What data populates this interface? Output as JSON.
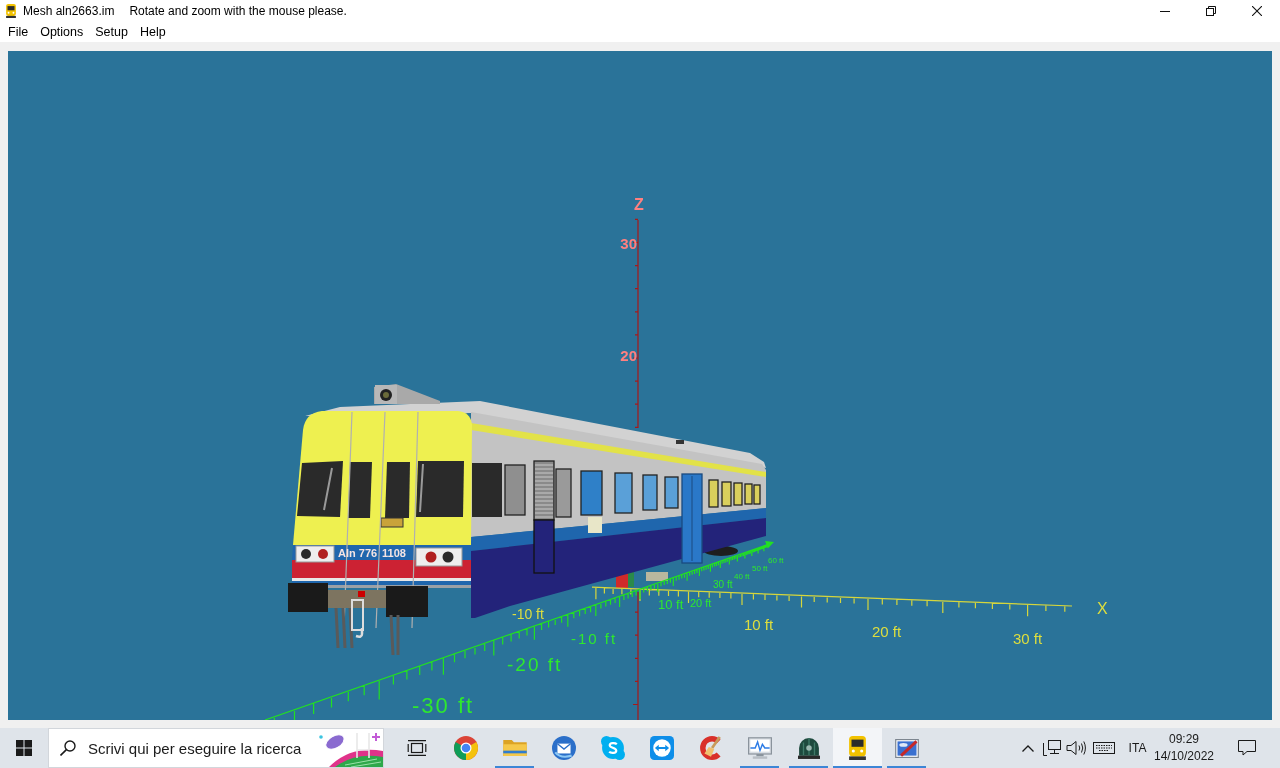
{
  "window": {
    "title": "Mesh aln2663.im",
    "hint": "Rotate and zoom with the mouse please."
  },
  "menu": [
    "File",
    "Options",
    "Setup",
    "Help"
  ],
  "viewport": {
    "axes": {
      "z": {
        "name": "Z",
        "labels": [
          "30",
          "20"
        ]
      },
      "x": {
        "name": "X",
        "labels": [
          "-10 ft",
          "10 ft",
          "20 ft",
          "30 ft"
        ]
      },
      "y": {
        "labels": [
          "-30 ft",
          "-20 ft",
          "-10 ft",
          "10 ft",
          "20 ft",
          "30 ft",
          "40 ft",
          "50 ft",
          "60 ft"
        ]
      }
    },
    "train": {
      "marking": "Aln 776",
      "number": "1108"
    }
  },
  "taskbar": {
    "search": {
      "placeholder": "Scrivi qui per eseguire la ricerca"
    },
    "apps": [
      {
        "kind": "browser",
        "running": false,
        "selected": false
      },
      {
        "kind": "folder",
        "running": true,
        "selected": false
      },
      {
        "kind": "mail",
        "running": false,
        "selected": false
      },
      {
        "kind": "chat",
        "running": false,
        "selected": false
      },
      {
        "kind": "remote",
        "running": false,
        "selected": false
      },
      {
        "kind": "cleaner",
        "running": false,
        "selected": false
      },
      {
        "kind": "monitor",
        "running": true,
        "selected": false
      },
      {
        "kind": "dome",
        "running": true,
        "selected": false
      },
      {
        "kind": "train",
        "running": true,
        "selected": true
      },
      {
        "kind": "paint",
        "running": true,
        "selected": false
      }
    ],
    "tray": {
      "language": "ITA",
      "time": "09:29",
      "date": "14/10/2022"
    }
  }
}
